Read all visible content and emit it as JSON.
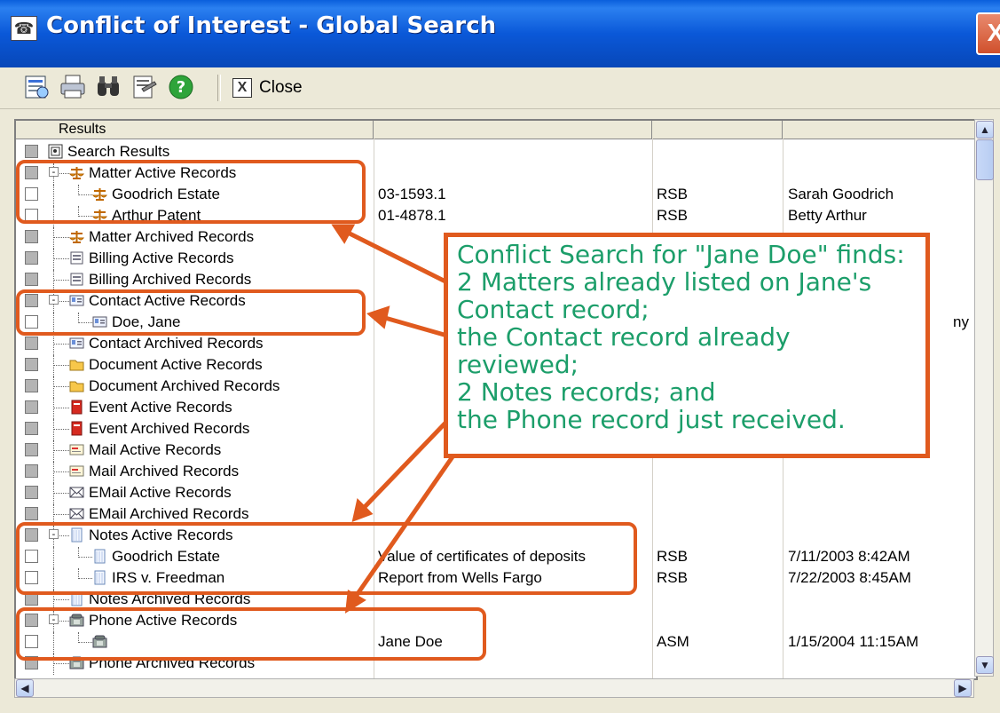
{
  "window": {
    "title": "Conflict of Interest - Global Search",
    "close_glyph": "X"
  },
  "toolbar": {
    "close_label": "Close",
    "close_glyph": "X"
  },
  "grid": {
    "columns": [
      "Results",
      "",
      "",
      ""
    ],
    "rows": [
      {
        "label": "Search Results",
        "icon": "search-results-icon",
        "col2": "",
        "col3": "",
        "col4": ""
      },
      {
        "label": "Matter Active Records",
        "icon": "scales-icon",
        "col2": "",
        "col3": "",
        "col4": ""
      },
      {
        "label": "Goodrich Estate",
        "icon": "scales-icon",
        "col2": "03-1593.1",
        "col3": "RSB",
        "col4": "Sarah Goodrich"
      },
      {
        "label": "Arthur Patent",
        "icon": "scales-icon",
        "col2": "01-4878.1",
        "col3": "RSB",
        "col4": "Betty Arthur"
      },
      {
        "label": "Matter Archived Records",
        "icon": "scales-icon",
        "col2": "",
        "col3": "",
        "col4": ""
      },
      {
        "label": "Billing Active Records",
        "icon": "billing-icon",
        "col2": "",
        "col3": "",
        "col4": ""
      },
      {
        "label": "Billing Archived Records",
        "icon": "billing-icon",
        "col2": "",
        "col3": "",
        "col4": ""
      },
      {
        "label": "Contact Active Records",
        "icon": "contact-card-icon",
        "col2": "",
        "col3": "",
        "col4": ""
      },
      {
        "label": "Doe, Jane",
        "icon": "contact-card-icon",
        "col2": "",
        "col3": "",
        "col4": "ny"
      },
      {
        "label": "Contact Archived Records",
        "icon": "contact-card-icon",
        "col2": "",
        "col3": "",
        "col4": ""
      },
      {
        "label": "Document Active Records",
        "icon": "folder-icon",
        "col2": "",
        "col3": "",
        "col4": ""
      },
      {
        "label": "Document Archived Records",
        "icon": "folder-icon",
        "col2": "",
        "col3": "",
        "col4": ""
      },
      {
        "label": "Event Active Records",
        "icon": "event-book-icon",
        "col2": "",
        "col3": "",
        "col4": ""
      },
      {
        "label": "Event Archived Records",
        "icon": "event-book-icon",
        "col2": "",
        "col3": "",
        "col4": ""
      },
      {
        "label": "Mail Active Records",
        "icon": "mail-icon",
        "col2": "",
        "col3": "",
        "col4": ""
      },
      {
        "label": "Mail Archived Records",
        "icon": "mail-icon",
        "col2": "",
        "col3": "",
        "col4": ""
      },
      {
        "label": "EMail Active Records",
        "icon": "envelope-icon",
        "col2": "",
        "col3": "",
        "col4": ""
      },
      {
        "label": "EMail Archived Records",
        "icon": "envelope-icon",
        "col2": "",
        "col3": "",
        "col4": ""
      },
      {
        "label": "Notes Active Records",
        "icon": "notepad-icon",
        "col2": "",
        "col3": "",
        "col4": ""
      },
      {
        "label": "Goodrich Estate",
        "icon": "notepad-icon",
        "col2": "Value of certificates of deposits",
        "col3": "RSB",
        "col4": "7/11/2003  8:42AM"
      },
      {
        "label": "IRS v. Freedman",
        "icon": "notepad-icon",
        "col2": "Report from Wells Fargo",
        "col3": "RSB",
        "col4": "7/22/2003  8:45AM"
      },
      {
        "label": "Notes Archived Records",
        "icon": "notepad-icon",
        "col2": "",
        "col3": "",
        "col4": ""
      },
      {
        "label": "Phone Active Records",
        "icon": "phone-icon",
        "col2": "",
        "col3": "",
        "col4": ""
      },
      {
        "label": "",
        "icon": "phone-icon",
        "col2": "Jane Doe",
        "col3": "ASM",
        "col4": "1/15/2004 11:15AM"
      },
      {
        "label": "Phone Archived Records",
        "icon": "phone-icon",
        "col2": "",
        "col3": "",
        "col4": ""
      }
    ]
  },
  "callout": {
    "lines": [
      "Conflict Search for \"Jane Doe\" finds:",
      "2 Matters already listed on Jane's",
      "Contact record;",
      "the Contact record already",
      "reviewed;",
      "2 Notes records; and",
      "the Phone record just received."
    ]
  },
  "colors": {
    "accent": "#e05a1e",
    "callout_text": "#1c9e6a",
    "titlebar": "#0a5fdc"
  }
}
